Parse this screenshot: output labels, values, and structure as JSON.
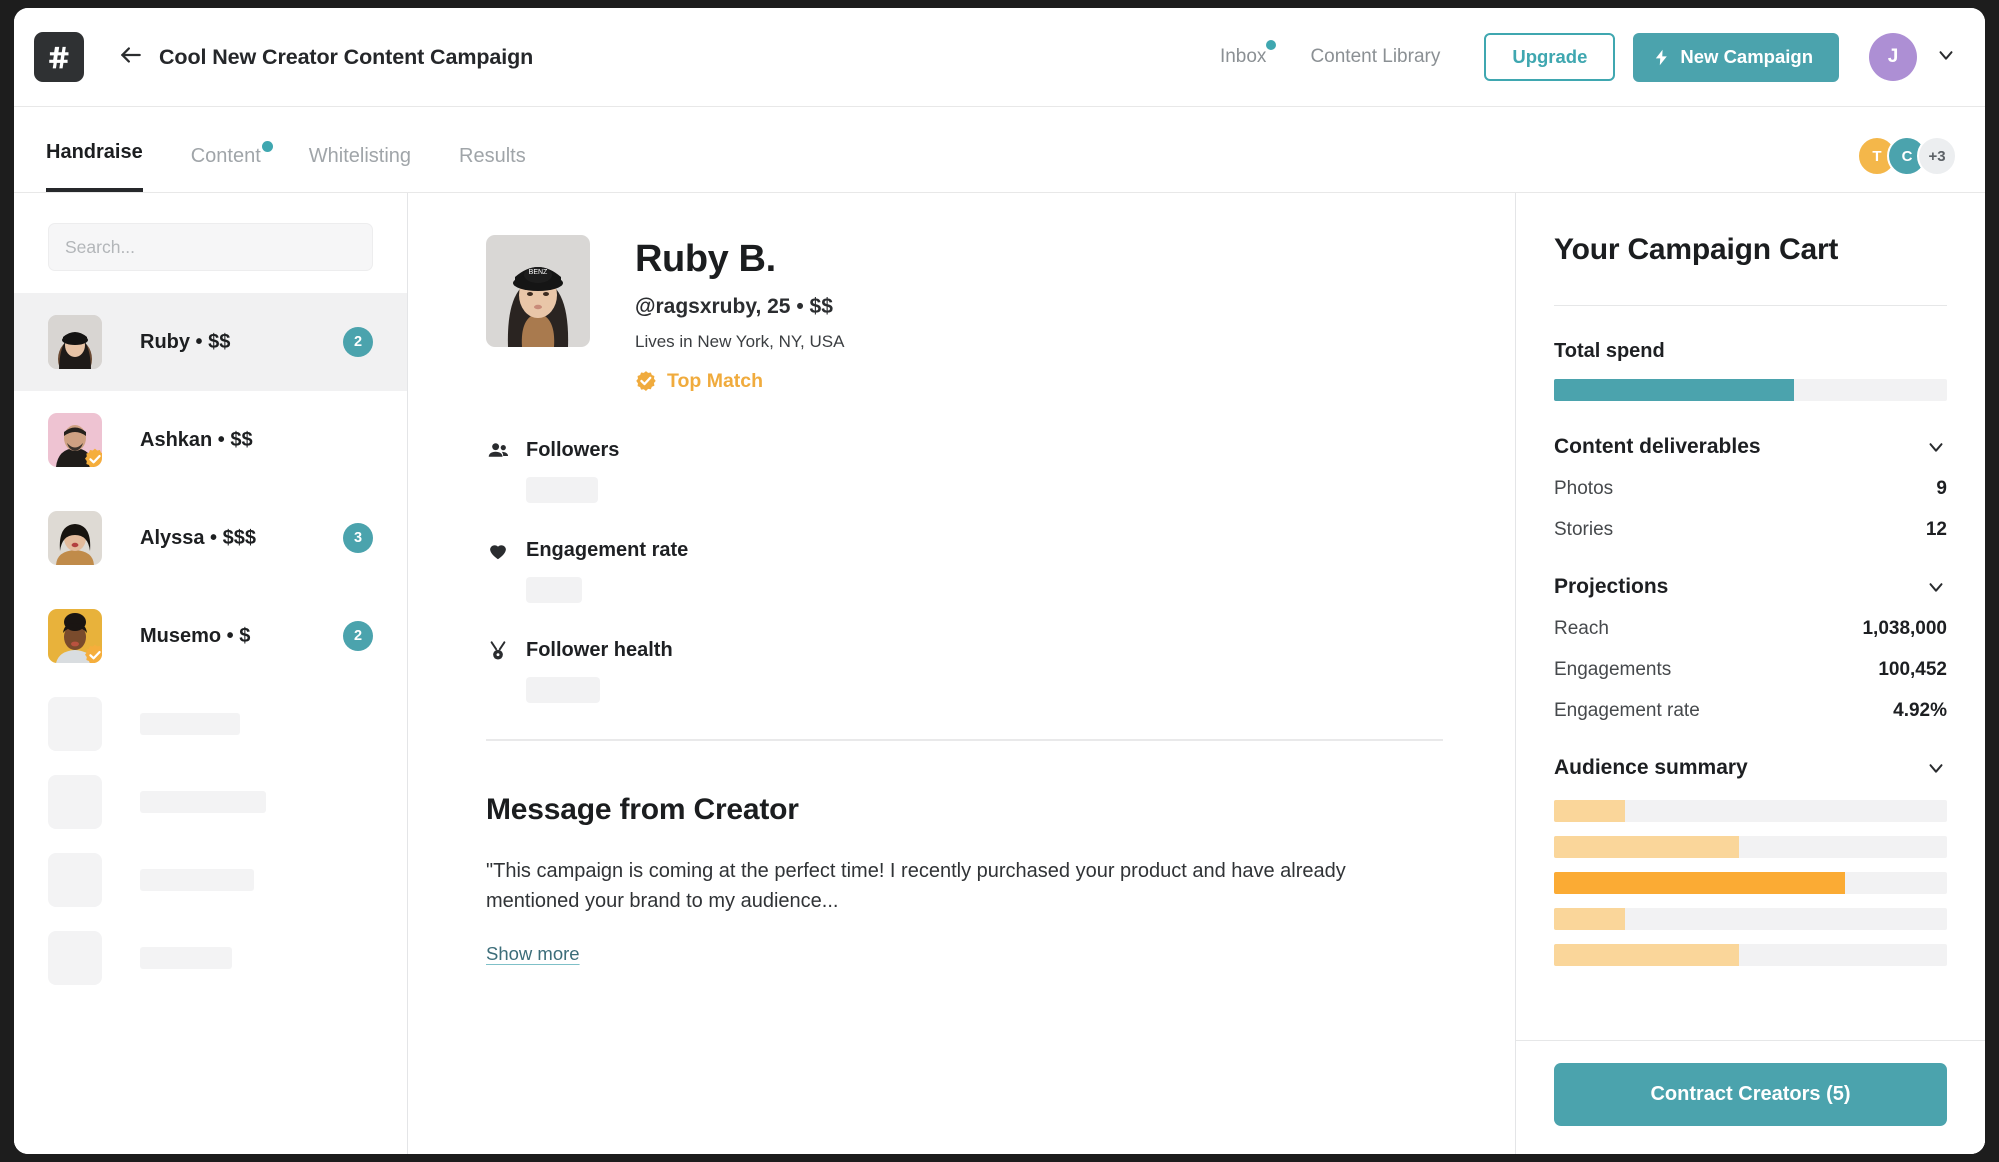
{
  "colors": {
    "teal": "#4ba3ad",
    "orange": "#f0ab3d",
    "orange_light": "#fad69a",
    "dark": "#2f3133",
    "purple": "#ad8fd4",
    "track": "#f2f2f3"
  },
  "topbar": {
    "logo_icon": "hash-icon",
    "back_icon": "arrow-left-icon",
    "campaign_title": "Cool New Creator Content Campaign",
    "nav": [
      {
        "label": "Inbox",
        "has_dot": true
      },
      {
        "label": "Content Library",
        "has_dot": false
      }
    ],
    "upgrade_label": "Upgrade",
    "new_campaign_label": "New Campaign",
    "new_campaign_icon": "lightning-bolt-icon",
    "user_initial": "J",
    "user_chevron_icon": "chevron-down-icon"
  },
  "tabs": [
    {
      "label": "Handraise",
      "active": true,
      "has_dot": false
    },
    {
      "label": "Content",
      "active": false,
      "has_dot": true
    },
    {
      "label": "Whitelisting",
      "active": false,
      "has_dot": false
    },
    {
      "label": "Results",
      "active": false,
      "has_dot": false
    }
  ],
  "collaborators": [
    {
      "initial": "T",
      "color": "#f4b74a"
    },
    {
      "initial": "C",
      "color": "#4ba3ad"
    },
    {
      "initial": "+3",
      "color": "#eceef0"
    }
  ],
  "sidebar": {
    "search_placeholder": "Search...",
    "search_value": "",
    "creators": [
      {
        "name": "Ruby • $$",
        "badge": "2",
        "selected": true,
        "verified": false,
        "avatar_bg": "#d6d3d0",
        "hair": "#1e1a18",
        "skin": "#e7c3a6"
      },
      {
        "name": "Ashkan • $$",
        "badge": "",
        "selected": false,
        "verified": true,
        "avatar_bg": "#eec3d2",
        "hair": "#26211d",
        "skin": "#cfa183"
      },
      {
        "name": "Alyssa • $$$",
        "badge": "3",
        "selected": false,
        "verified": false,
        "avatar_bg": "#dedad4",
        "hair": "#17130f",
        "skin": "#e3bb9c"
      },
      {
        "name": "Musemo • $",
        "badge": "2",
        "selected": false,
        "verified": true,
        "avatar_bg": "#e8b23b",
        "hair": "#1a1512",
        "skin": "#7a4b2c"
      }
    ],
    "skeleton_rows": [
      {
        "line_width": 100
      },
      {
        "line_width": 126
      },
      {
        "line_width": 114
      },
      {
        "line_width": 92
      }
    ]
  },
  "profile": {
    "name": "Ruby B.",
    "handle_line": "@ragsxruby, 25 • $$",
    "location": "Lives in New York, NY, USA",
    "top_match_label": "Top Match",
    "top_match_icon": "verified-badge-icon",
    "stats": [
      {
        "label": "Followers",
        "icon": "people-icon",
        "value": "",
        "placeholder_width": 72
      },
      {
        "label": "Engagement rate",
        "icon": "heart-icon",
        "value": "",
        "placeholder_width": 56
      },
      {
        "label": "Follower health",
        "icon": "medal-icon",
        "value": "",
        "placeholder_width": 74
      }
    ],
    "message_title": "Message from Creator",
    "message_body": "\"This campaign is coming at the perfect time! I recently purchased your product and have already mentioned your brand to my audience...",
    "show_more_label": "Show more"
  },
  "cart": {
    "title": "Your Campaign Cart",
    "total_spend_label": "Total spend",
    "total_spend_percent": 61,
    "sections": [
      {
        "title": "Content deliverables",
        "chevron_icon": "chevron-down-icon",
        "rows": [
          {
            "key": "Photos",
            "value": "9"
          },
          {
            "key": "Stories",
            "value": "12"
          }
        ]
      },
      {
        "title": "Projections",
        "chevron_icon": "chevron-down-icon",
        "rows": [
          {
            "key": "Reach",
            "value": "1,038,000"
          },
          {
            "key": "Engagements",
            "value": "100,452"
          },
          {
            "key": "Engagement rate",
            "value": "4.92%"
          }
        ]
      }
    ],
    "audience": {
      "title": "Audience summary",
      "chevron_icon": "chevron-down-icon",
      "bars": [
        {
          "percent": 18,
          "color": "#fad69a"
        },
        {
          "percent": 47,
          "color": "#fad69a"
        },
        {
          "percent": 74,
          "color": "#fbab34"
        },
        {
          "percent": 18,
          "color": "#fad69a"
        },
        {
          "percent": 47,
          "color": "#fad69a"
        }
      ]
    },
    "contract_button_label": "Contract Creators (5)"
  }
}
